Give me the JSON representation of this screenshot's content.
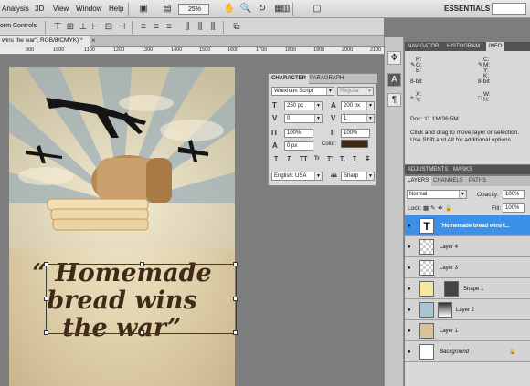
{
  "menubar": {
    "items": [
      "Analysis",
      "3D",
      "View",
      "Window",
      "Help"
    ],
    "zoom": "25%",
    "workspace": "ESSENTIALS"
  },
  "options_bar": {
    "label": "orm Controls"
  },
  "document": {
    "tab_title": "wins the war\", RGB/8/CMYK) *",
    "close": "×",
    "ruler_numbers": [
      "900",
      "1000",
      "1100",
      "1200",
      "1300",
      "1400",
      "1500",
      "1600",
      "1700",
      "1800",
      "1900",
      "2000",
      "2100"
    ]
  },
  "poster": {
    "lines": [
      "“ Homemade",
      "bread wins",
      "the war”"
    ],
    "text_color": "#3f2a18"
  },
  "character_panel": {
    "tabs": [
      "CHARACTER",
      "PARAGRAPH"
    ],
    "font_family": "Wrexham Script",
    "font_style": "Regular",
    "font_size": "250 px",
    "leading": "200 px",
    "kerning": "0",
    "tracking": "1",
    "vertical_scale": "100%",
    "horizontal_scale": "100%",
    "baseline_shift": "0 px",
    "color_label": "Color:",
    "color": "#3e2b14",
    "language": "English: USA",
    "aa_label": "aa",
    "antialias": "Sharp",
    "style_buttons": [
      "T",
      "T",
      "TT",
      "Tr",
      "T'",
      "T,",
      "T",
      "T"
    ]
  },
  "info_panel": {
    "tabs": [
      "NAVIGATOR",
      "HISTOGRAM",
      "INFO"
    ],
    "rgb_labels": [
      "R:",
      "G:",
      "B:"
    ],
    "cmyk_labels": [
      "C:",
      "M:",
      "Y:",
      "K:"
    ],
    "bit_left": "8-bit",
    "bit_right": "8-bit",
    "xy_labels": [
      "X:",
      "Y:"
    ],
    "wh_labels": [
      "W:",
      "H:"
    ],
    "doc": "Doc: 11.1M/36.5M",
    "hint": "Click and drag to move layer or selection. Use Shift and Alt for additional options."
  },
  "adjust_tabs": [
    "ADJUSTMENTS",
    "MASKS"
  ],
  "layers_panel": {
    "tabs": [
      "LAYERS",
      "CHANNELS",
      "PATHS"
    ],
    "blend_mode": "Normal",
    "opacity_label": "Opacity:",
    "opacity": "100%",
    "lock_label": "Lock:",
    "fill_label": "Fill:",
    "fill": "100%",
    "layers": [
      {
        "name": "\"Homemade bread wins t...",
        "thumb": "T",
        "selected": true
      },
      {
        "name": "Layer 4",
        "thumb": "",
        "selected": false
      },
      {
        "name": "Layer 3",
        "thumb": "",
        "selected": false
      },
      {
        "name": "Shape 1",
        "thumb": "",
        "selected": false
      },
      {
        "name": "Layer 2",
        "thumb": "",
        "selected": false
      },
      {
        "name": "Layer 1",
        "thumb": "",
        "selected": false
      },
      {
        "name": "Background",
        "thumb": "",
        "selected": false
      }
    ]
  }
}
